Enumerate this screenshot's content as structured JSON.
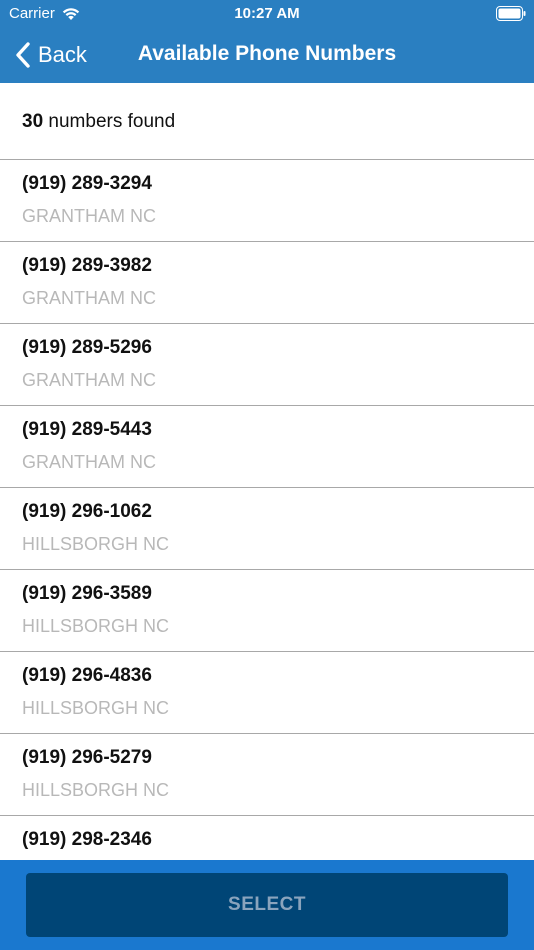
{
  "status_bar": {
    "carrier": "Carrier",
    "time": "10:27 AM"
  },
  "nav": {
    "back_label": "Back",
    "title": "Available Phone Numbers"
  },
  "results": {
    "count": "30",
    "suffix": " numbers found"
  },
  "numbers": [
    {
      "number": "(919) 289-3294",
      "city": "GRANTHAM NC"
    },
    {
      "number": "(919) 289-3982",
      "city": "GRANTHAM NC"
    },
    {
      "number": "(919) 289-5296",
      "city": "GRANTHAM NC"
    },
    {
      "number": "(919) 289-5443",
      "city": "GRANTHAM NC"
    },
    {
      "number": "(919) 296-1062",
      "city": "HILLSBORGH NC"
    },
    {
      "number": "(919) 296-3589",
      "city": "HILLSBORGH NC"
    },
    {
      "number": "(919) 296-4836",
      "city": "HILLSBORGH NC"
    },
    {
      "number": "(919) 296-5279",
      "city": "HILLSBORGH NC"
    },
    {
      "number": "(919) 298-2346",
      "city": ""
    }
  ],
  "footer": {
    "select_label": "SELECT"
  },
  "colors": {
    "nav_bar": "#2a7fc1",
    "footer": "#1a78cf",
    "select_button": "#004576",
    "city_text": "#b8b8b8"
  },
  "icons": {
    "wifi": "wifi-icon",
    "battery": "battery-icon",
    "back": "chevron-left-icon"
  }
}
